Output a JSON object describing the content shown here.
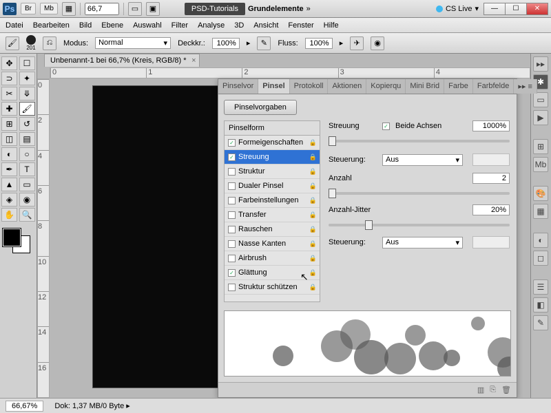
{
  "titlebar": {
    "logo": "Ps",
    "chips": [
      "Br",
      "Mb"
    ],
    "zoom": "66,7",
    "center_badge": "PSD-Tutorials",
    "center_text": "Grundelemente",
    "cslive": "CS Live"
  },
  "menu": [
    "Datei",
    "Bearbeiten",
    "Bild",
    "Ebene",
    "Auswahl",
    "Filter",
    "Analyse",
    "3D",
    "Ansicht",
    "Fenster",
    "Hilfe"
  ],
  "options": {
    "brush_size": "201",
    "mode_label": "Modus:",
    "mode_value": "Normal",
    "opacity_label": "Deckkr.:",
    "opacity_value": "100%",
    "flow_label": "Fluss:",
    "flow_value": "100%"
  },
  "document": {
    "tab": "Unbenannt-1 bei 66,7% (Kreis, RGB/8) *",
    "ruler_h": [
      "0",
      "1",
      "2",
      "3",
      "4"
    ],
    "ruler_v": [
      "0",
      "2",
      "4",
      "6",
      "8",
      "10",
      "12",
      "14",
      "16"
    ]
  },
  "panel": {
    "tabs": [
      "Pinselvor",
      "Pinsel",
      "Protokoll",
      "Aktionen",
      "Kopierqu",
      "Mini Brid",
      "Farbe",
      "Farbfelde"
    ],
    "active_tab": 1,
    "presets_btn": "Pinselvorgaben",
    "shape_header": "Pinselform",
    "options": [
      {
        "label": "Formeigenschaften",
        "checked": true,
        "lock": true
      },
      {
        "label": "Streuung",
        "checked": true,
        "lock": true,
        "selected": true
      },
      {
        "label": "Struktur",
        "checked": false,
        "lock": true
      },
      {
        "label": "Dualer Pinsel",
        "checked": false,
        "lock": true
      },
      {
        "label": "Farbeinstellungen",
        "checked": false,
        "lock": true
      },
      {
        "label": "Transfer",
        "checked": false,
        "lock": true
      },
      {
        "label": "Rauschen",
        "checked": false,
        "lock": true
      },
      {
        "label": "Nasse Kanten",
        "checked": false,
        "lock": true
      },
      {
        "label": "Airbrush",
        "checked": false,
        "lock": true
      },
      {
        "label": "Glättung",
        "checked": true,
        "lock": true
      },
      {
        "label": "Struktur schützen",
        "checked": false,
        "lock": true
      }
    ],
    "settings": {
      "scatter_label": "Streuung",
      "both_axes_label": "Beide Achsen",
      "both_axes_checked": true,
      "scatter_value": "1000%",
      "control_label": "Steuerung:",
      "control_value": "Aus",
      "count_label": "Anzahl",
      "count_value": "2",
      "count_jitter_label": "Anzahl-Jitter",
      "count_jitter_value": "20%",
      "control2_label": "Steuerung:",
      "control2_value": "Aus"
    }
  },
  "status": {
    "zoom": "66,67%",
    "doc_label": "Dok:",
    "doc_value": "1,37 MB/0 Byte"
  },
  "colors": {
    "accent": "#2f72d4",
    "canvas": "#0a0a0a"
  }
}
